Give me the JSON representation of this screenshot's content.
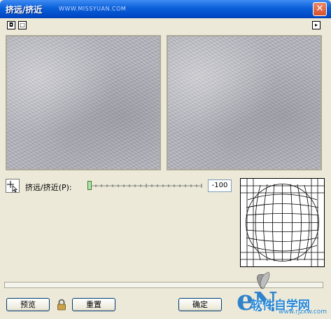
{
  "window": {
    "title": "挤远/挤近",
    "watermark": "WWW.MISSYUAN.COM",
    "close_glyph": "✕"
  },
  "toolbar": {
    "fit_glyph": "◘",
    "zoom_glyph": "□",
    "menu_glyph": "▸"
  },
  "control": {
    "label": "挤远/挤近(P):",
    "value": "-100",
    "slider_fraction": 0
  },
  "buttons": {
    "preview_label": "预览",
    "reset_label": "重置",
    "ok_label": "确定"
  },
  "branding": {
    "text": "软件自学网",
    "url": "www.rjzxw.com"
  },
  "icons": {
    "title": "butterfly-icon",
    "tool": "move-tool-icon",
    "lock": "lock-icon"
  }
}
